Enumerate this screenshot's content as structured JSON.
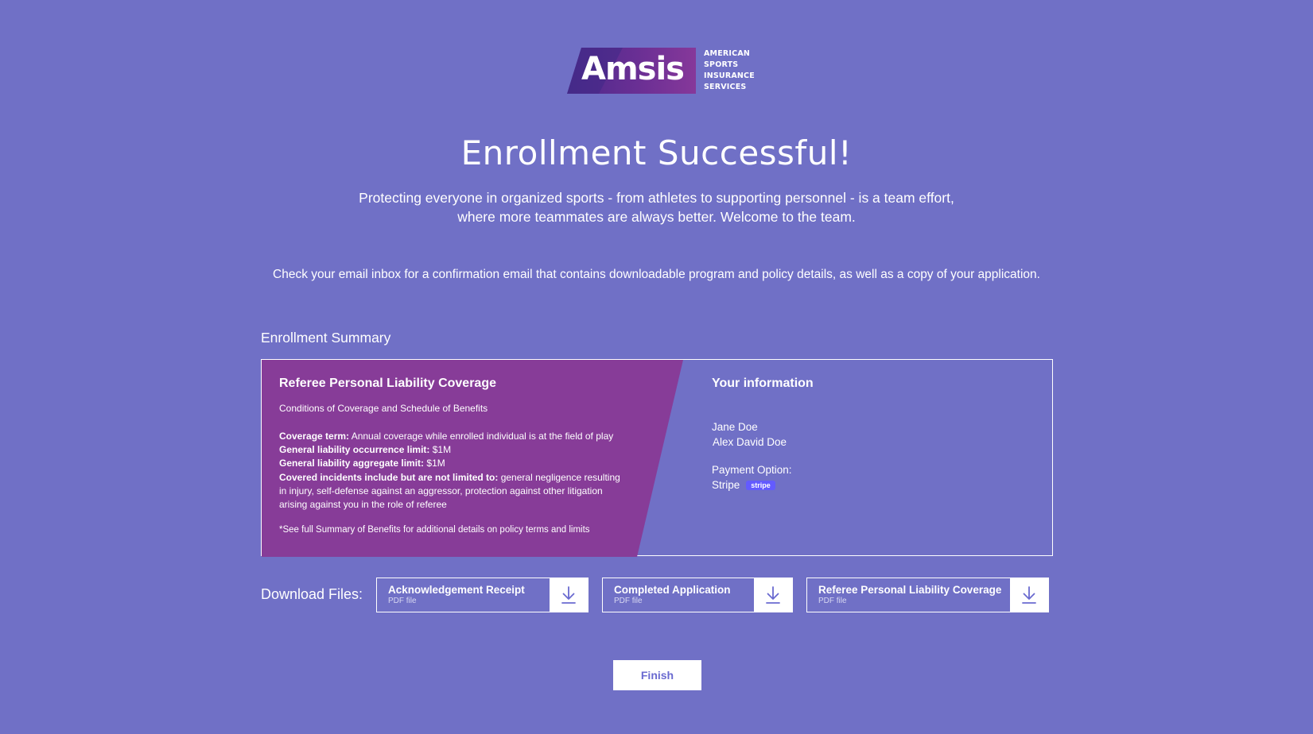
{
  "brand": {
    "logo_word": "Amsis",
    "tagline": [
      "AMERICAN",
      "SPORTS",
      "INSURANCE",
      "SERVICES"
    ],
    "colors": {
      "logo_dark": "#4b2a8c",
      "logo_purple": "#86389a",
      "background": "#7070c6",
      "panel": "#873c98"
    }
  },
  "header": {
    "title": "Enrollment Successful!",
    "subtitle_line1": "Protecting everyone in organized sports - from athletes to supporting personnel - is a team effort,",
    "subtitle_line2": "where more teammates are always better. Welcome to the team.",
    "notice": "Check your email inbox for a confirmation email that contains downloadable program and policy details, as well as a copy of your application."
  },
  "summary": {
    "section_label": "Enrollment Summary",
    "coverage": {
      "title": "Referee Personal Liability Coverage",
      "subtitle": "Conditions of Coverage and Schedule of Benefits",
      "term_label": "Coverage term:",
      "term_value": " Annual coverage while enrolled individual is at the field of play",
      "occurrence_label": "General liability occurrence limit:",
      "occurrence_value": " $1M",
      "aggregate_label": "General liability aggregate limit:",
      "aggregate_value": " $1M",
      "incidents_label": "Covered incidents include but are not limited to:",
      "incidents_value": " general negligence resulting in injury, self-defense against an aggressor, protection against other litigation arising against you in the role of referee",
      "note": "*See full Summary of Benefits for additional details on policy terms and limits"
    },
    "info": {
      "title": "Your information",
      "name1": "Jane Doe",
      "name2": "Alex David Doe",
      "payment_label": "Payment Option:",
      "payment_value": "Stripe",
      "payment_badge": "stripe"
    }
  },
  "downloads": {
    "label": "Download Files:",
    "items": [
      {
        "name": "Acknowledgement Receipt",
        "type": "PDF file",
        "icon": "download-icon"
      },
      {
        "name": "Completed Application",
        "type": "PDF file",
        "icon": "download-icon"
      },
      {
        "name": "Referee Personal Liability Coverage",
        "type": "PDF file",
        "icon": "download-icon"
      }
    ]
  },
  "actions": {
    "finish_label": "Finish"
  }
}
